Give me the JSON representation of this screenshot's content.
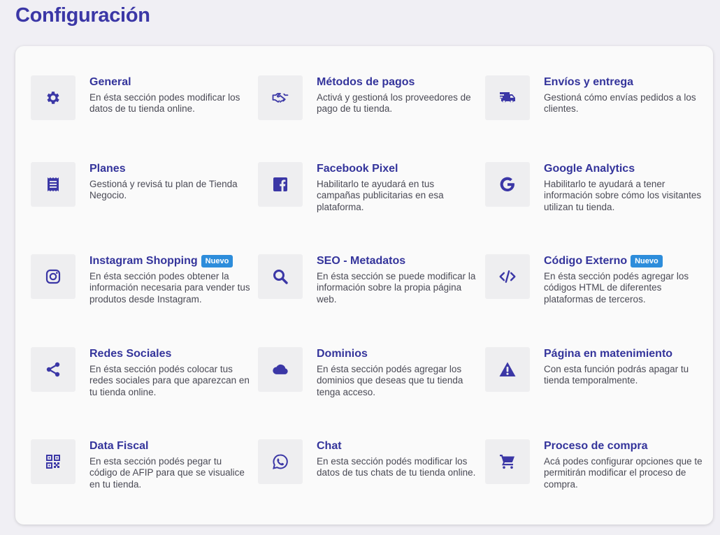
{
  "page": {
    "title": "Configuración"
  },
  "theme": {
    "accent": "#3b37a6",
    "badge": "#2d8ddb"
  },
  "items": [
    {
      "title": "General",
      "desc": "En ésta sección podes modificar los datos de tu tienda online.",
      "badge": "",
      "icon": "gear-icon"
    },
    {
      "title": "Métodos de pagos",
      "desc": "Activá y gestioná los proveedores de pago de tu tienda.",
      "badge": "",
      "icon": "handshake-icon"
    },
    {
      "title": "Envíos y entrega",
      "desc": "Gestioná cómo envías pedidos a los clientes.",
      "badge": "",
      "icon": "truck-icon"
    },
    {
      "title": "Planes",
      "desc": "Gestioná y revisá tu plan de Tienda Negocio.",
      "badge": "",
      "icon": "receipt-icon"
    },
    {
      "title": "Facebook Pixel",
      "desc": "Habilitarlo te ayudará en tus campañas publicitarias en esa plataforma.",
      "badge": "",
      "icon": "facebook-icon"
    },
    {
      "title": "Google Analytics",
      "desc": "Habilitarlo te ayudará a tener información sobre cómo los visitantes utilizan tu tienda.",
      "badge": "",
      "icon": "google-icon"
    },
    {
      "title": "Instagram Shopping",
      "desc": "En ésta sección podes obtener la información necesaria para vender tus produtos desde Instagram.",
      "badge": "Nuevo",
      "icon": "instagram-icon"
    },
    {
      "title": "SEO - Metadatos",
      "desc": "En ésta sección se puede modificar la información sobre la propia página web.",
      "badge": "",
      "icon": "search-icon"
    },
    {
      "title": "Código Externo",
      "desc": "En ésta sección podés agregar los códigos HTML de diferentes plataformas de terceros.",
      "badge": "Nuevo",
      "icon": "code-icon"
    },
    {
      "title": "Redes Sociales",
      "desc": "En ésta sección podés colocar tus redes sociales para que aparezcan en tu tienda online.",
      "badge": "",
      "icon": "share-icon"
    },
    {
      "title": "Dominios",
      "desc": "En ésta sección podés agregar los dominios que deseas que tu tienda tenga acceso.",
      "badge": "",
      "icon": "cloud-icon"
    },
    {
      "title": "Página en matenimiento",
      "desc": "Con esta función podrás apagar tu tienda temporalmente.",
      "badge": "",
      "icon": "warning-icon"
    },
    {
      "title": "Data Fiscal",
      "desc": "En esta sección podés pegar tu código de AFIP para que se visualice en tu tienda.",
      "badge": "",
      "icon": "qr-code-icon"
    },
    {
      "title": "Chat",
      "desc": "En esta sección podés modificar los datos de tus chats de tu tienda online.",
      "badge": "",
      "icon": "whatsapp-icon"
    },
    {
      "title": "Proceso de compra",
      "desc": "Acá podes configurar opciones que te permitirán modificar el proceso de compra.",
      "badge": "",
      "icon": "cart-icon"
    }
  ]
}
